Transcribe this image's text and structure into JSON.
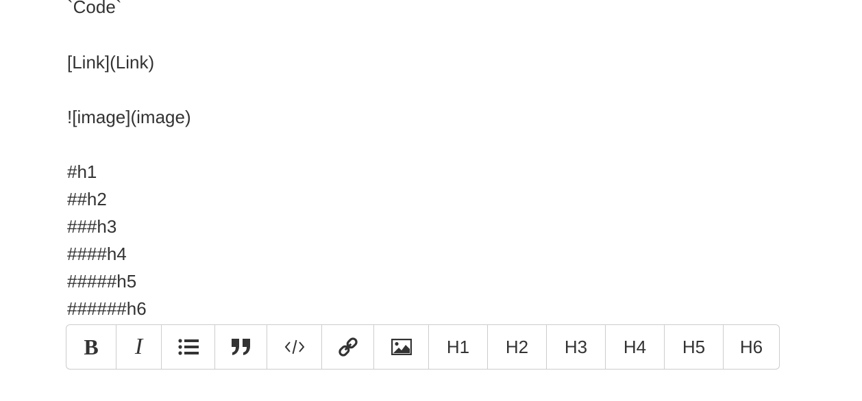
{
  "editor": {
    "lines": [
      "`Code`",
      "[Link](Link)",
      "![image](image)",
      "#h1",
      "##h2",
      "###h3",
      "####h4",
      "#####h5",
      "######h6"
    ]
  },
  "toolbar": {
    "bold_label": "B",
    "italic_label": "I",
    "list_icon": "list-icon",
    "quote_icon": "quote-icon",
    "code_icon": "code-icon",
    "link_icon": "link-icon",
    "image_icon": "image-icon",
    "h1_label": "H1",
    "h2_label": "H2",
    "h3_label": "H3",
    "h4_label": "H4",
    "h5_label": "H5",
    "h6_label": "H6"
  },
  "colors": {
    "text": "#333333",
    "border": "#cccccc",
    "background": "#ffffff"
  }
}
